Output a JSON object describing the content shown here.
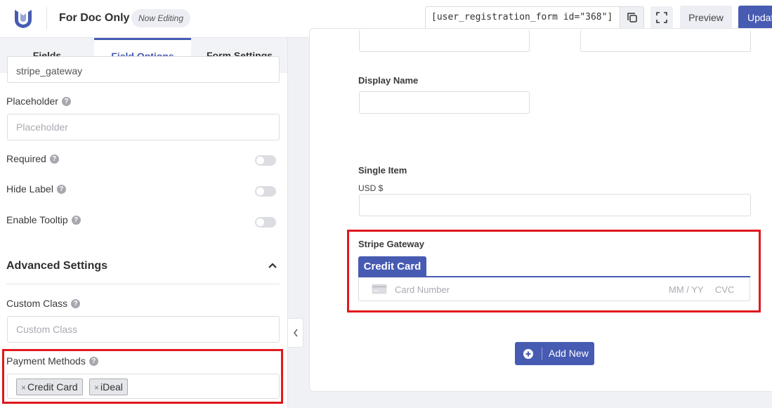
{
  "header": {
    "form_title": "For Doc Only",
    "status_badge": "Now Editing",
    "shortcode": "[user_registration_form id=\"368\"]",
    "preview_label": "Preview",
    "update_label": "Update"
  },
  "tabs": [
    {
      "label": "Fields"
    },
    {
      "label": "Field Options"
    },
    {
      "label": "Form Settings"
    }
  ],
  "options": {
    "top_input_value": "stripe_gateway",
    "placeholder_label": "Placeholder",
    "placeholder_input_placeholder": "Placeholder",
    "required_label": "Required",
    "hide_label_label": "Hide Label",
    "enable_tooltip_label": "Enable Tooltip",
    "help_glyph": "?"
  },
  "advanced": {
    "title": "Advanced Settings",
    "custom_class_label": "Custom Class",
    "custom_class_placeholder": "Custom Class",
    "payment_methods_label": "Payment Methods",
    "payment_methods": [
      "Credit Card",
      "iDeal"
    ],
    "chip_remove_glyph": "×"
  },
  "canvas": {
    "display_name_label": "Display Name",
    "single_item_label": "Single Item",
    "single_item_currency": "USD $",
    "stripe_label": "Stripe Gateway",
    "credit_card_tab": "Credit Card",
    "card_number_placeholder": "Card Number",
    "expiry_placeholder": "MM / YY",
    "cvc_placeholder": "CVC",
    "add_new_label": "Add New"
  },
  "colors": {
    "accent": "#475bb2",
    "highlight": "#e0181e"
  }
}
